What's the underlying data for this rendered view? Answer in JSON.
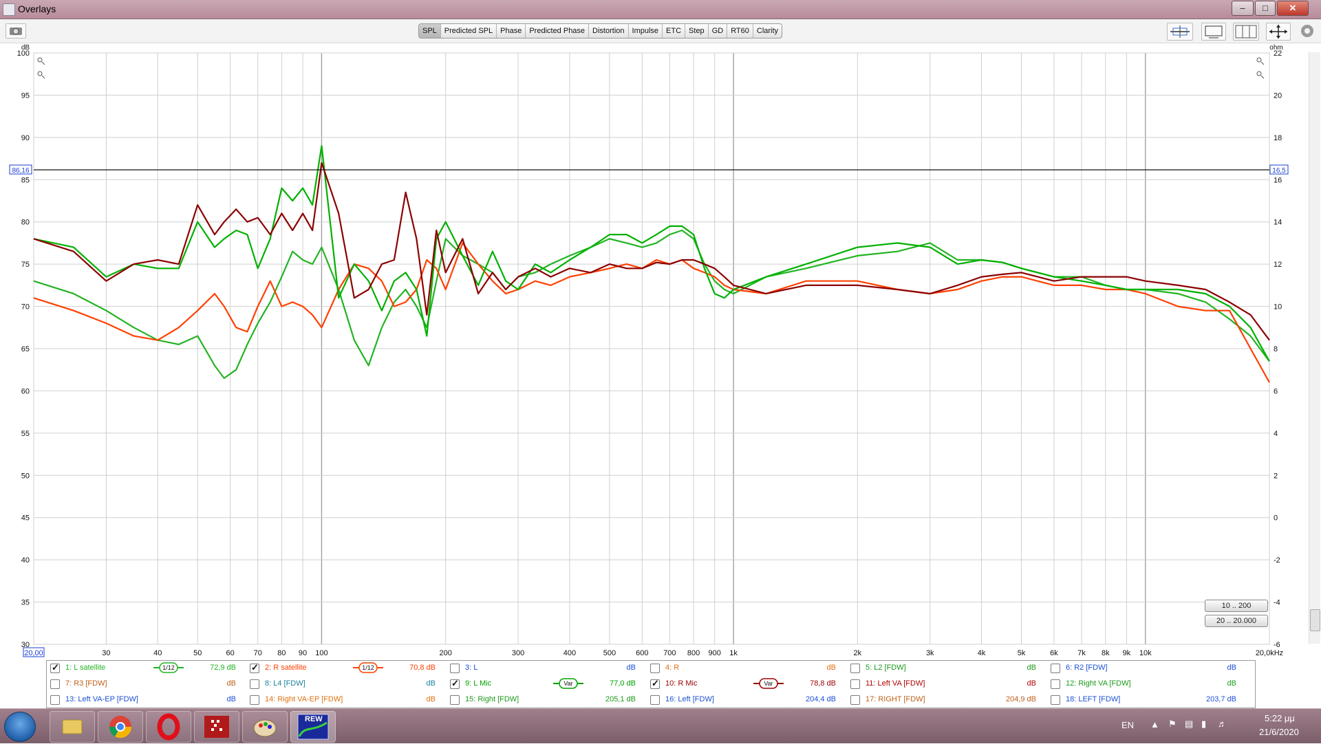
{
  "window": {
    "title": "Overlays",
    "minimize": "–",
    "maximize": "□",
    "close": "✕"
  },
  "toolbar": {
    "tabs": [
      "SPL",
      "Predicted SPL",
      "Phase",
      "Predicted Phase",
      "Distortion",
      "Impulse",
      "ETC",
      "Step",
      "GD",
      "RT60",
      "Clarity"
    ],
    "active_tab": "SPL",
    "icons": [
      "camera-icon",
      "zoom-limits-icon",
      "fit-window-icon",
      "grid-view-icon",
      "pan-arrows-icon",
      "gear-icon"
    ]
  },
  "chart_data": {
    "type": "line",
    "xscale": "log",
    "xlim": [
      20,
      20000
    ],
    "ylim": [
      30,
      100
    ],
    "y2lim": [
      -6,
      22
    ],
    "y2label": "ohm",
    "ylabel": "dB",
    "x_ticks": [
      "20,00",
      "30",
      "40",
      "50",
      "60",
      "70",
      "80",
      "90",
      "100",
      "200",
      "300",
      "400",
      "500",
      "600",
      "700",
      "800",
      "900",
      "1k",
      "2k",
      "3k",
      "4k",
      "5k",
      "6k",
      "7k",
      "8k",
      "9k",
      "10k",
      "20,0kHz"
    ],
    "y_ticks": [
      "100",
      "95",
      "90",
      "85",
      "80",
      "75",
      "70",
      "65",
      "60",
      "55",
      "50",
      "45",
      "40",
      "35",
      "30"
    ],
    "y2_ticks": [
      "22",
      "20",
      "18",
      "16",
      "14",
      "12",
      "10",
      "8",
      "6",
      "4",
      "2",
      "0",
      "-2",
      "-4",
      "-6"
    ],
    "cursor": {
      "y_label": "86,16",
      "y2_label": "16,5",
      "y_value": 86.16
    },
    "grid": true,
    "series": [
      {
        "name": "1: L satellite",
        "color": "#22b322",
        "x": [
          20,
          25,
          30,
          35,
          40,
          45,
          50,
          55,
          58,
          62,
          66,
          70,
          75,
          80,
          85,
          90,
          95,
          100,
          110,
          120,
          130,
          140,
          150,
          160,
          170,
          180,
          190,
          200,
          220,
          240,
          260,
          280,
          300,
          330,
          360,
          400,
          450,
          500,
          550,
          600,
          650,
          700,
          750,
          800,
          850,
          900,
          950,
          1000,
          1200,
          1500,
          2000,
          2500,
          3000,
          3500,
          4000,
          4500,
          5000,
          6000,
          7000,
          8000,
          9000,
          10000,
          12000,
          14000,
          16000,
          18000,
          20000
        ],
        "y": [
          73,
          71.5,
          69.5,
          67.5,
          66,
          65.5,
          66.5,
          63,
          61.5,
          62.5,
          65.5,
          68,
          70.5,
          73.5,
          76.5,
          75.5,
          75,
          77,
          72,
          66,
          63,
          67.5,
          70.5,
          72,
          70,
          67.5,
          73,
          78,
          76,
          75,
          74,
          72,
          73.5,
          74,
          75,
          76,
          77,
          78,
          77.5,
          77,
          77.5,
          78.5,
          79,
          78,
          75,
          73,
          72,
          71.5,
          73.5,
          74.5,
          76,
          76.5,
          77.5,
          75.5,
          75.5,
          75.2,
          74.5,
          73.5,
          73.5,
          72.5,
          72,
          72,
          71.5,
          70.5,
          68.5,
          66.5,
          63.5
        ]
      },
      {
        "name": "2: R satellite",
        "color": "#ff4000",
        "x": [
          20,
          25,
          30,
          35,
          40,
          45,
          50,
          55,
          58,
          62,
          66,
          70,
          75,
          80,
          85,
          90,
          95,
          100,
          110,
          120,
          130,
          140,
          150,
          160,
          170,
          180,
          190,
          200,
          220,
          240,
          260,
          280,
          300,
          330,
          360,
          400,
          450,
          500,
          550,
          600,
          650,
          700,
          750,
          800,
          850,
          900,
          950,
          1000,
          1200,
          1500,
          2000,
          2500,
          3000,
          3500,
          4000,
          4500,
          5000,
          6000,
          7000,
          8000,
          9000,
          10000,
          12000,
          14000,
          16000,
          18000,
          20000
        ],
        "y": [
          71,
          69.5,
          68,
          66.5,
          66,
          67.5,
          69.5,
          71.5,
          70,
          67.5,
          67,
          70,
          73,
          70,
          70.5,
          70,
          69,
          67.5,
          72,
          75,
          74.5,
          73,
          70,
          70.5,
          72,
          75.5,
          74.5,
          72,
          77.5,
          75,
          73,
          71.5,
          72,
          73,
          72.5,
          73.5,
          74,
          74.5,
          75,
          74.5,
          75.5,
          75,
          75.5,
          74.5,
          74,
          73.5,
          72.5,
          72,
          71.5,
          73,
          73,
          72,
          71.5,
          72,
          73,
          73.5,
          73.5,
          72.5,
          72.5,
          72,
          72,
          71.5,
          70,
          69.5,
          69.5,
          65,
          61
        ]
      },
      {
        "name": "9: L Mic",
        "color": "#00b000",
        "x": [
          20,
          25,
          30,
          35,
          40,
          45,
          50,
          55,
          58,
          62,
          66,
          70,
          75,
          80,
          85,
          90,
          95,
          100,
          110,
          120,
          130,
          140,
          150,
          160,
          170,
          180,
          190,
          200,
          220,
          240,
          260,
          280,
          300,
          330,
          360,
          400,
          450,
          500,
          550,
          600,
          650,
          700,
          750,
          800,
          850,
          900,
          950,
          1000,
          1200,
          1500,
          2000,
          2500,
          3000,
          3500,
          4000,
          4500,
          5000,
          6000,
          7000,
          8000,
          9000,
          10000,
          12000,
          14000,
          16000,
          18000,
          20000
        ],
        "y": [
          78,
          77,
          73.5,
          75,
          74.5,
          74.5,
          80,
          77,
          78,
          79,
          78.5,
          74.5,
          78,
          84,
          82.5,
          84,
          82,
          89,
          71,
          75,
          73,
          69.5,
          73,
          74,
          72,
          66.5,
          78,
          80,
          76,
          72.5,
          76.5,
          73,
          72,
          75,
          74,
          75.5,
          77,
          78.5,
          78.5,
          77.5,
          78.5,
          79.5,
          79.5,
          78.5,
          74.5,
          71.5,
          71,
          72,
          73.5,
          75,
          77,
          77.5,
          77,
          75,
          75.5,
          75.2,
          74.5,
          73.5,
          73,
          72.5,
          72,
          72,
          72,
          71.5,
          70,
          67.5,
          63.5
        ]
      },
      {
        "name": "10: R Mic",
        "color": "#8b0000",
        "x": [
          20,
          25,
          30,
          35,
          40,
          45,
          50,
          55,
          58,
          62,
          66,
          70,
          75,
          80,
          85,
          90,
          95,
          100,
          110,
          120,
          130,
          140,
          150,
          160,
          170,
          180,
          190,
          200,
          220,
          240,
          260,
          280,
          300,
          330,
          360,
          400,
          450,
          500,
          550,
          600,
          650,
          700,
          750,
          800,
          850,
          900,
          950,
          1000,
          1200,
          1500,
          2000,
          2500,
          3000,
          3500,
          4000,
          4500,
          5000,
          6000,
          7000,
          8000,
          9000,
          10000,
          12000,
          14000,
          16000,
          18000,
          20000
        ],
        "y": [
          78,
          76.5,
          73,
          75,
          75.5,
          75,
          82,
          78.5,
          80,
          81.5,
          80,
          80.5,
          78.5,
          81,
          79,
          81,
          79,
          87,
          81,
          71,
          72,
          75,
          75.5,
          83.5,
          78,
          69,
          79,
          74,
          78,
          71.5,
          74,
          72,
          73.5,
          74.5,
          73.5,
          74.5,
          74,
          75,
          74.5,
          74.5,
          75.2,
          75,
          75.5,
          75.5,
          75,
          74.5,
          73.5,
          72.5,
          71.5,
          72.5,
          72.5,
          72,
          71.5,
          72.5,
          73.5,
          73.8,
          74,
          73,
          73.5,
          73.5,
          73.5,
          73,
          72.5,
          72,
          70.5,
          69,
          66
        ]
      }
    ]
  },
  "legend": {
    "items": [
      {
        "label": "1: L satellite",
        "value": "72,9 dB",
        "checked": true,
        "color": "#22b322",
        "smoothing": "1/12"
      },
      {
        "label": "2: R satellite",
        "value": "70,8 dB",
        "checked": true,
        "color": "#ff4000",
        "smoothing": "1/12"
      },
      {
        "label": "3: L",
        "value": "dB",
        "checked": false,
        "color": "#1a4fd6"
      },
      {
        "label": "4: R",
        "value": "dB",
        "checked": false,
        "color": "#e07010"
      },
      {
        "label": "5: L2 [FDW]",
        "value": "dB",
        "checked": false,
        "color": "#1a9a1a"
      },
      {
        "label": "6: R2 [FDW]",
        "value": "dB",
        "checked": false,
        "color": "#1a4fd6"
      },
      {
        "label": "7: R3 [FDW]",
        "value": "dB",
        "checked": false,
        "color": "#c0601a"
      },
      {
        "label": "8: L4 [FDW]",
        "value": "dB",
        "checked": false,
        "color": "#1a7fa0"
      },
      {
        "label": "9: L Mic",
        "value": "77,0 dB",
        "checked": true,
        "color": "#00a000",
        "smoothing": "Var"
      },
      {
        "label": "10: R Mic",
        "value": "78,8 dB",
        "checked": true,
        "color": "#9a0000",
        "smoothing": "Var"
      },
      {
        "label": "11: Left VA [FDW]",
        "value": "dB",
        "checked": false,
        "color": "#b00000"
      },
      {
        "label": "12: Right VA [FDW]",
        "value": "dB",
        "checked": false,
        "color": "#1a9a1a"
      },
      {
        "label": "13: Left VA-EP [FDW]",
        "value": "dB",
        "checked": false,
        "color": "#1a4fd6"
      },
      {
        "label": "14: Right VA-EP [FDW]",
        "value": "dB",
        "checked": false,
        "color": "#e07010"
      },
      {
        "label": "15: Right [FDW]",
        "value": "205,1 dB",
        "checked": false,
        "color": "#1a9a1a"
      },
      {
        "label": "16: Left [FDW]",
        "value": "204,4 dB",
        "checked": false,
        "color": "#1a4fd6"
      },
      {
        "label": "17: RIGHT [FDW]",
        "value": "204,9 dB",
        "checked": false,
        "color": "#c0601a"
      },
      {
        "label": "18: LEFT [FDW]",
        "value": "203,7 dB",
        "checked": false,
        "color": "#1a4fd6"
      }
    ]
  },
  "zoom_presets": [
    "10 .. 200",
    "20 .. 20.000"
  ],
  "taskbar": {
    "apps": [
      "windows-explorer",
      "chrome",
      "opera",
      "app-red",
      "paint",
      "REW"
    ],
    "rew_label": "REW",
    "language": "EN",
    "time": "5:22 μμ",
    "date": "21/6/2020"
  }
}
